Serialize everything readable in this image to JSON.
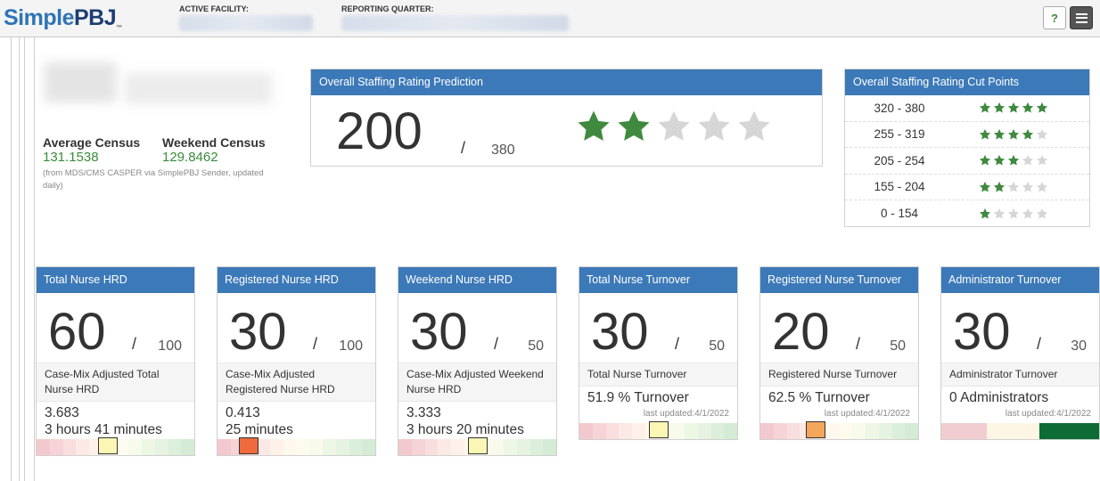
{
  "header": {
    "logo_simple": "Simple",
    "logo_pbj": "PBJ",
    "logo_tm": "™",
    "active_facility_label": "ACTIVE FACILITY:",
    "reporting_quarter_label": "REPORTING QUARTER:",
    "help_label": "?"
  },
  "census": {
    "avg_label": "Average Census",
    "avg_value": "131.1538",
    "weekend_label": "Weekend Census",
    "weekend_value": "129.8462",
    "note": "(from MDS/CMS CASPER via SimplePBJ Sender, updated daily)"
  },
  "prediction": {
    "title": "Overall Staffing Rating Prediction",
    "score": "200",
    "slash": "/",
    "max": "380",
    "stars_filled": 2,
    "stars_total": 5
  },
  "cut_points": {
    "title": "Overall Staffing Rating Cut Points",
    "rows": [
      {
        "range": "320 - 380",
        "stars": 5
      },
      {
        "range": "255 - 319",
        "stars": 4
      },
      {
        "range": "205 - 254",
        "stars": 3
      },
      {
        "range": "155 - 204",
        "stars": 2
      },
      {
        "range": "0 - 154",
        "stars": 1
      }
    ]
  },
  "colors": {
    "header_blue": "#3c79b8",
    "star_green": "#3f8a3f",
    "star_gray": "#d6d6d6",
    "value_green": "#3a8a3a"
  },
  "cards": [
    {
      "title": "Total Nurse HRD",
      "score": "60",
      "slash": "/",
      "max": "100",
      "desc": "Case-Mix Adjusted Total Nurse HRD",
      "line1": "3.683",
      "line2": "3 hours 41 minutes",
      "updated": "",
      "scale": "gradient",
      "marker_pos": 0.45,
      "marker_color": "#fbf6b4"
    },
    {
      "title": "Registered Nurse HRD",
      "score": "30",
      "slash": "/",
      "max": "100",
      "desc": "Case-Mix Adjusted Registered Nurse HRD",
      "line1": "0.413",
      "line2": "25 minutes",
      "updated": "",
      "scale": "gradient",
      "marker_pos": 0.2,
      "marker_color": "#ef6a3c"
    },
    {
      "title": "Weekend Nurse HRD",
      "score": "30",
      "slash": "/",
      "max": "50",
      "desc": "Case-Mix Adjusted Weekend Nurse HRD",
      "line1": "3.333",
      "line2": "3 hours 20 minutes",
      "updated": "",
      "scale": "gradient",
      "marker_pos": 0.5,
      "marker_color": "#fbf6b4"
    },
    {
      "title": "Total Nurse Turnover",
      "score": "30",
      "slash": "/",
      "max": "50",
      "desc": "Total Nurse Turnover",
      "line1": "51.9 % Turnover",
      "line2": "",
      "updated": "last updated:4/1/2022",
      "scale": "gradient",
      "marker_pos": 0.5,
      "marker_color": "#fbf6b4"
    },
    {
      "title": "Registered Nurse Turnover",
      "score": "20",
      "slash": "/",
      "max": "50",
      "desc": "Registered Nurse Turnover",
      "line1": "62.5 % Turnover",
      "line2": "",
      "updated": "last updated:4/1/2022",
      "scale": "gradient",
      "marker_pos": 0.35,
      "marker_color": "#f4a65a"
    },
    {
      "title": "Administrator Turnover",
      "score": "30",
      "slash": "/",
      "max": "30",
      "desc": "Administrator Turnover",
      "line1": "0 Administrators",
      "line2": "",
      "updated": "last updated:4/1/2022",
      "scale": "admin",
      "marker_pos": -1,
      "marker_color": ""
    }
  ]
}
